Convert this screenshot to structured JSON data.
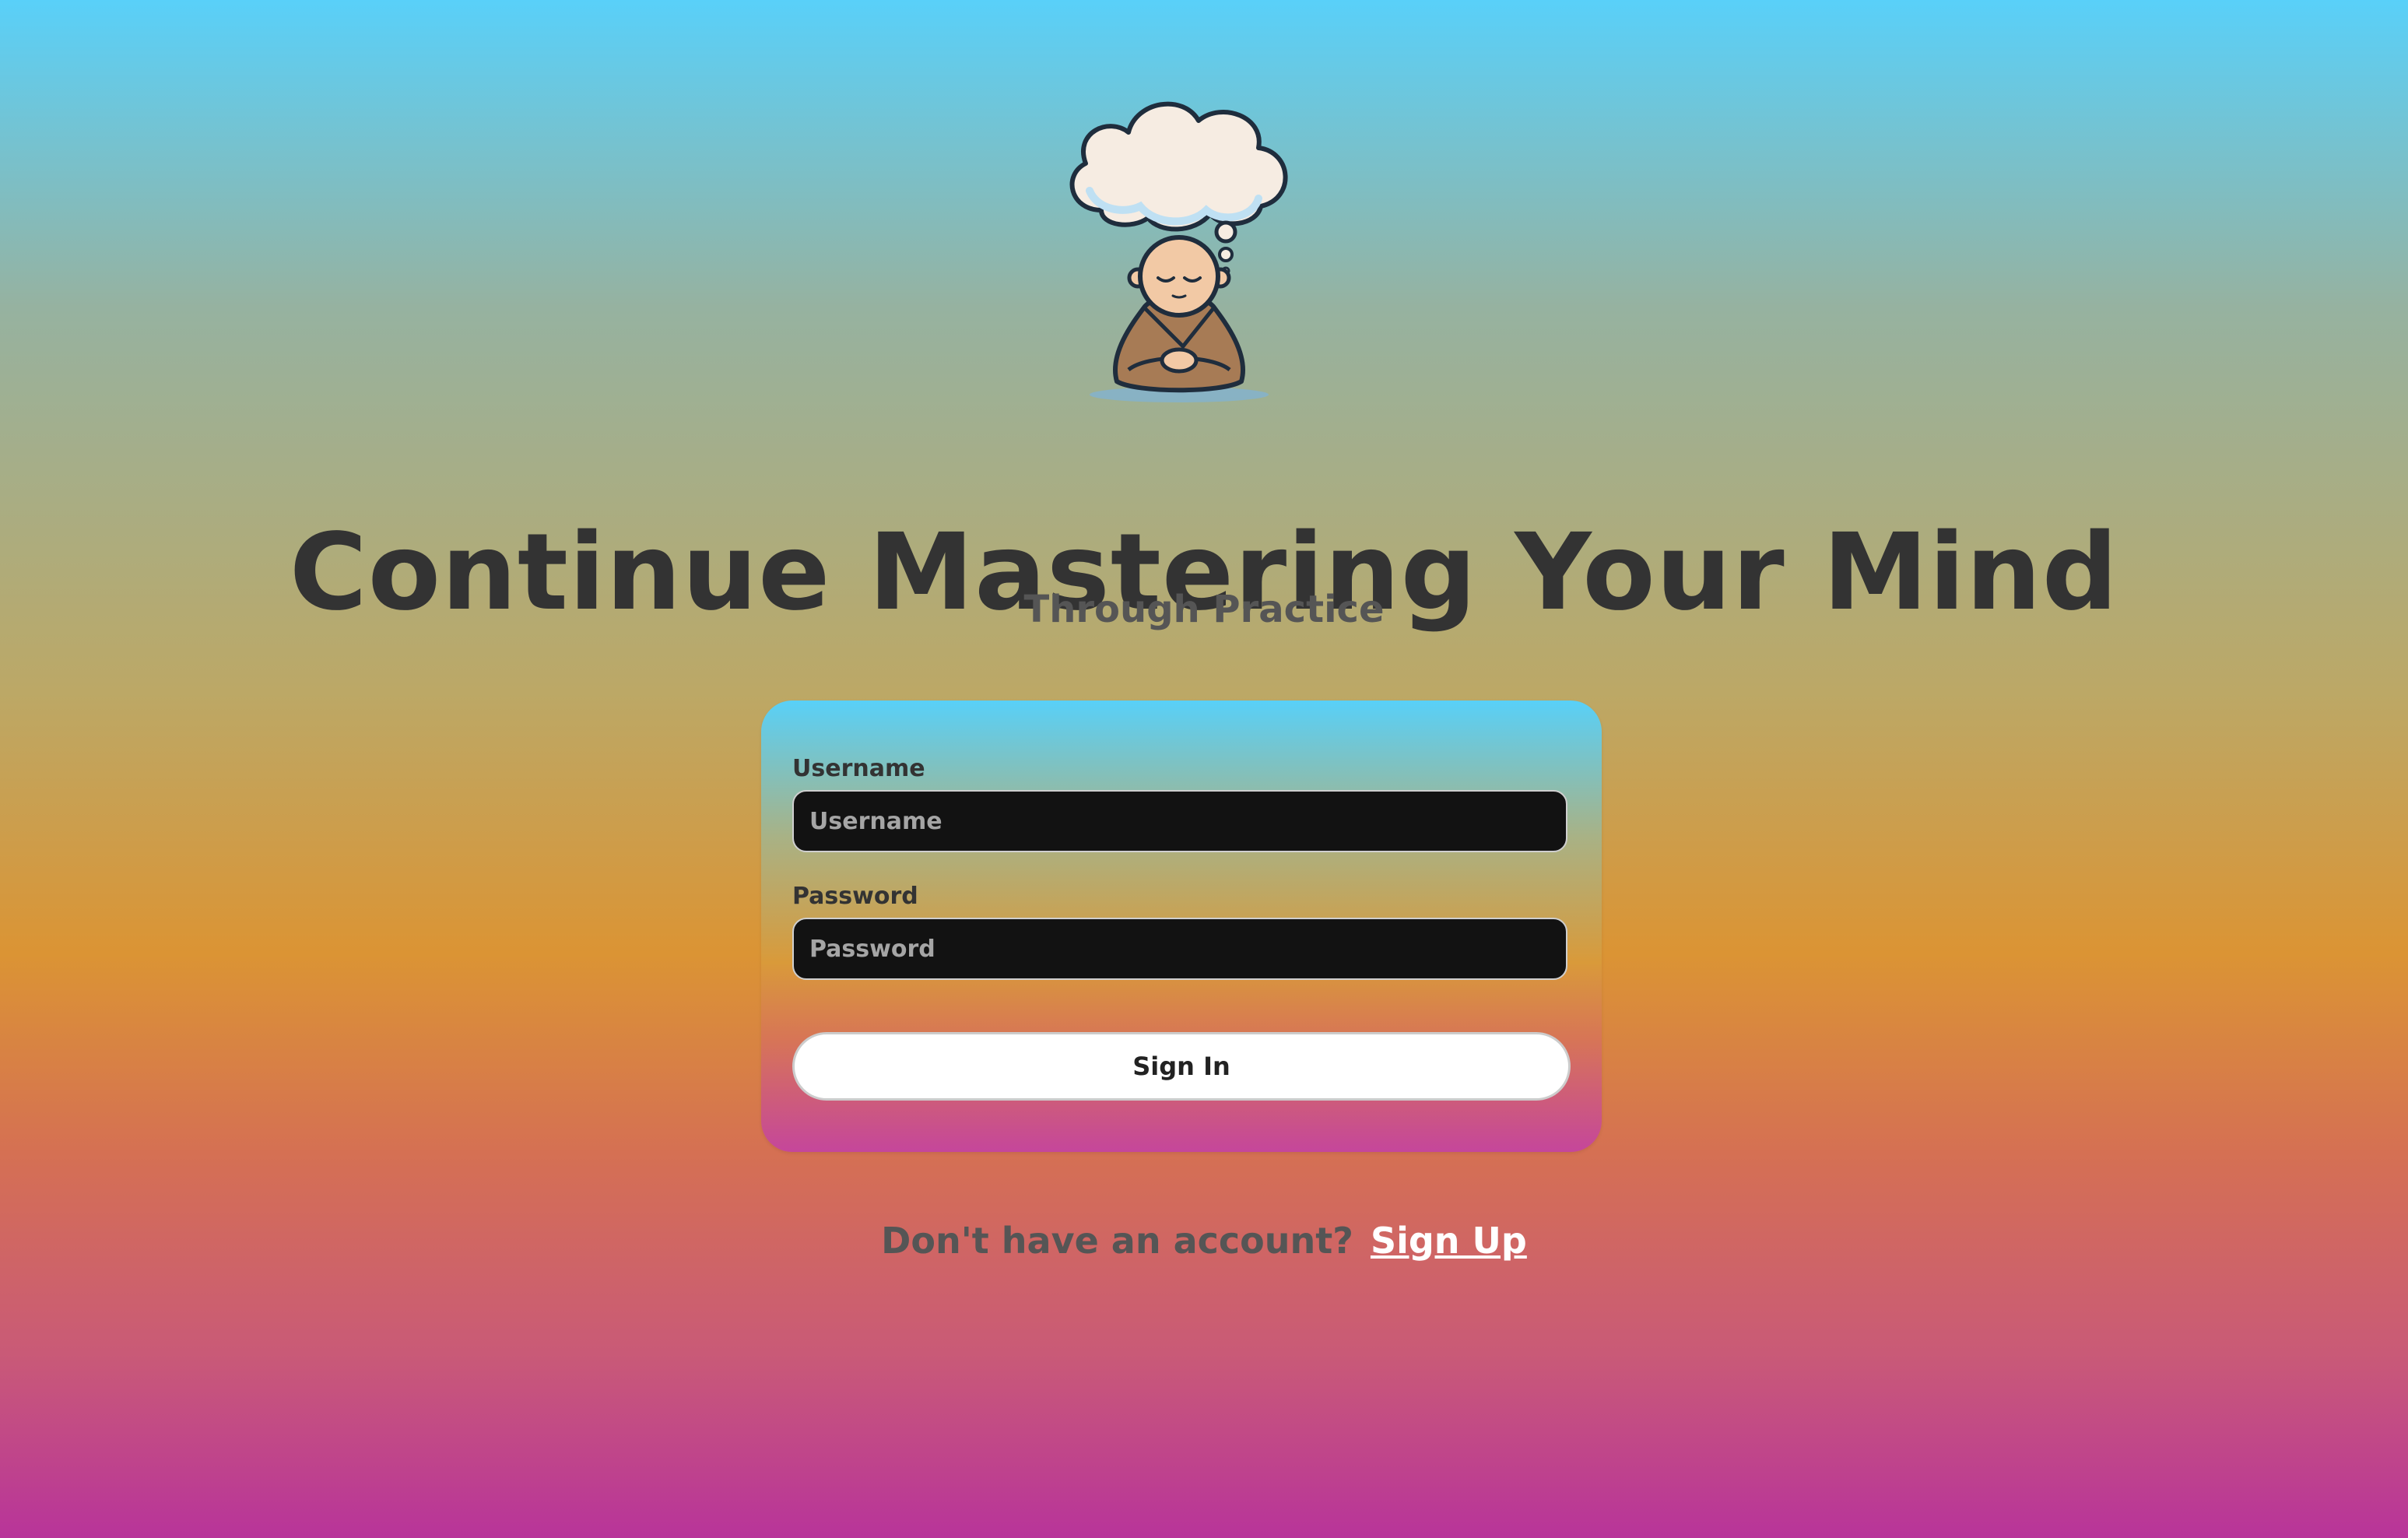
{
  "hero": {
    "title": "Continue Mastering Your Mind",
    "subtitle": "Through Practice",
    "illustration": "meditating-monk-thought-cloud-icon"
  },
  "form": {
    "username_label": "Username",
    "username_placeholder": "Username",
    "username_value": "",
    "password_label": "Password",
    "password_placeholder": "Password",
    "password_value": "",
    "submit_label": "Sign In"
  },
  "footer": {
    "prompt": "Don't have an account?",
    "signup_label": "Sign Up"
  },
  "colors": {
    "background_top": "#59d0f9",
    "background_bottom": "#b8349a",
    "input_bg": "#121212",
    "button_bg": "#ffffff",
    "text_dark": "#333333"
  }
}
